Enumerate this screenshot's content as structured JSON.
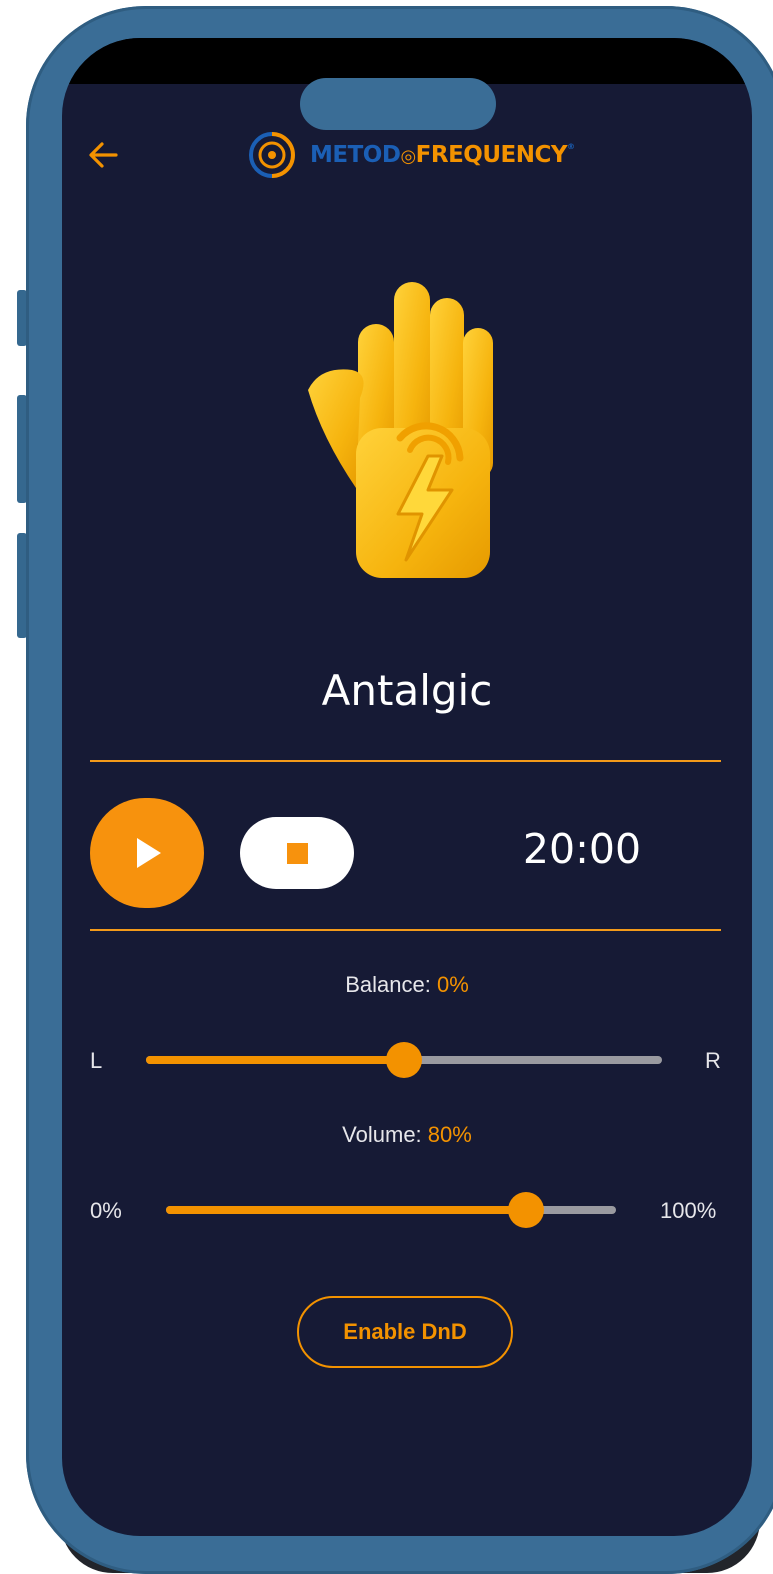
{
  "header": {
    "back_icon": "arrow-left-icon",
    "logo": {
      "part1": "METOD",
      "part2": "FREQUENCY",
      "reg": "®"
    }
  },
  "program": {
    "icon": "hand-lightning-icon",
    "title": "Antalgic"
  },
  "player": {
    "play_icon": "play-icon",
    "stop_icon": "stop-icon",
    "timer": "20:00"
  },
  "balance": {
    "label": "Balance: ",
    "value": "0%",
    "left_label": "L",
    "right_label": "R",
    "level": 0.5
  },
  "volume": {
    "label": "Volume: ",
    "value": "80%",
    "min_label": "0%",
    "max_label": "100%",
    "level": 0.8
  },
  "dnd_button": {
    "label": "Enable DnD"
  },
  "colors": {
    "accent": "#f39200",
    "background": "#161a35",
    "frame": "#3a6d96",
    "logo_blue": "#1b5fb5"
  }
}
